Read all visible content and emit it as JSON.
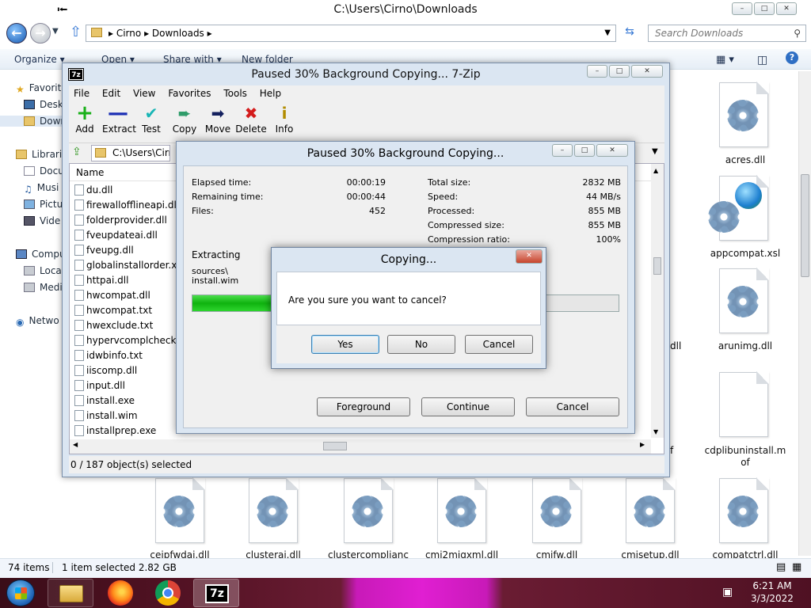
{
  "explorer": {
    "title": "C:\\Users\\Cirno\\Downloads",
    "breadcrumb": [
      "Cirno",
      "Downloads"
    ],
    "search_placeholder": "Search Downloads",
    "commands": {
      "organize": "Organize",
      "open": "Open",
      "share_with": "Share with",
      "new_folder": "New folder"
    },
    "nav": [
      "Favorit",
      "Deskt",
      "Down",
      "Librarie",
      "Docu",
      "Musi",
      "Pictu",
      "Vide",
      "Compu",
      "Local",
      "Medi",
      "Netwo"
    ],
    "files": [
      "acres.dll",
      "appcompat.xsl",
      "arunimg.dll",
      "cdplibuninstall.mof",
      "ceipfwdai.dll",
      "clusterai.dll",
      "clustercomplianc",
      "cmi2migxml.dll",
      "cmifw.dll",
      "cmisetup.dll",
      "compatctrl.dll"
    ],
    "partial_labels": [
      "dll",
      "f"
    ],
    "status": {
      "items": "74 items",
      "selected": "1 item selected  2.82 GB"
    }
  },
  "taskbar": {
    "time": "6:21 AM",
    "date": "3/3/2022",
    "app_7z_label": "7z"
  },
  "zip": {
    "title": "Paused 30% Background Copying... 7-Zip",
    "icon_label": "7z",
    "menu": [
      "File",
      "Edit",
      "View",
      "Favorites",
      "Tools",
      "Help"
    ],
    "toolbar": [
      "Add",
      "Extract",
      "Test",
      "Copy",
      "Move",
      "Delete",
      "Info"
    ],
    "path": "C:\\Users\\Cirno",
    "column_name": "Name",
    "rows": [
      "du.dll",
      "firewallofflineapi.dll",
      "folderprovider.dll",
      "fveupdateai.dll",
      "fveupg.dll",
      "globalinstallorder.xm",
      "httpai.dll",
      "hwcompat.dll",
      "hwcompat.txt",
      "hwexclude.txt",
      "hypervcomplcheck.d",
      "idwbinfo.txt",
      "iiscomp.dll",
      "input.dll",
      "install.exe",
      "install.wim",
      "installprep.exe"
    ],
    "status": "0 / 187 object(s) selected"
  },
  "progress": {
    "title": "Paused 30% Background Copying...",
    "left": [
      {
        "label": "Elapsed time:",
        "value": "00:00:19"
      },
      {
        "label": "Remaining time:",
        "value": "00:00:44"
      },
      {
        "label": "Files:",
        "value": "452"
      }
    ],
    "right": [
      {
        "label": "Total size:",
        "value": "2832 MB"
      },
      {
        "label": "Speed:",
        "value": "44 MB/s"
      },
      {
        "label": "Processed:",
        "value": "855 MB"
      },
      {
        "label": "Compressed size:",
        "value": "855 MB"
      },
      {
        "label": "Compression ratio:",
        "value": "100%"
      }
    ],
    "action": "Extracting",
    "current_path": "sources\\",
    "current_file": "install.wim",
    "percent": 30,
    "buttons": {
      "foreground": "Foreground",
      "continue": "Continue",
      "cancel": "Cancel"
    }
  },
  "confirm": {
    "title": "Copying...",
    "message": "Are you sure you want to cancel?",
    "buttons": {
      "yes": "Yes",
      "no": "No",
      "cancel": "Cancel"
    }
  }
}
